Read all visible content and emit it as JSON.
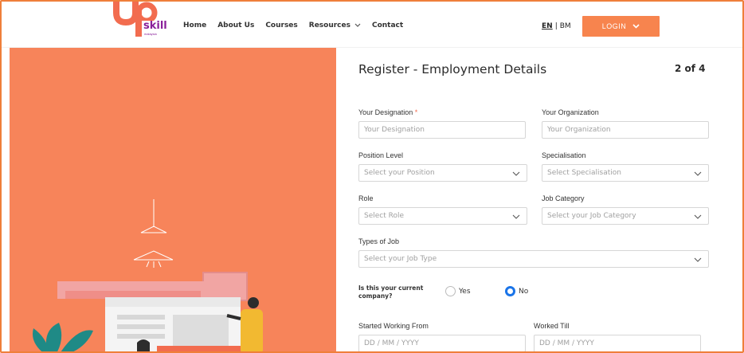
{
  "header": {
    "logo_text_top": "up",
    "logo_text_bottom": "skill",
    "logo_sub": "malaysia",
    "nav": [
      "Home",
      "About Us",
      "Courses",
      "Resources",
      "Contact"
    ],
    "lang_en": "EN",
    "lang_sep": "|",
    "lang_bm": "BM",
    "login_label": "LOGIN"
  },
  "form": {
    "title": "Register - Employment Details",
    "step": "2 of 4",
    "designation": {
      "label": "Your Designation",
      "required": "*",
      "placeholder": "Your Designation"
    },
    "organization": {
      "label": "Your Organization",
      "placeholder": "Your Organization"
    },
    "position_level": {
      "label": "Position Level",
      "placeholder": "Select your Position"
    },
    "specialisation": {
      "label": "Specialisation",
      "placeholder": "Select Specialisation"
    },
    "role": {
      "label": "Role",
      "placeholder": "Select Role"
    },
    "job_category": {
      "label": "Job Category",
      "placeholder": "Select your Job Category"
    },
    "types_of_job": {
      "label": "Types of Job",
      "placeholder": "Select your Job Type"
    },
    "current_company": {
      "label": "Is this your current company?",
      "yes": "Yes",
      "no": "No",
      "selected": "No"
    },
    "started": {
      "label": "Started Working From",
      "placeholder": "DD / MM / YYYY"
    },
    "worked_till": {
      "label": "Worked Till",
      "placeholder": "DD / MM / YYYY"
    }
  },
  "colors": {
    "brand_orange": "#f7844e",
    "panel_orange": "#f7845a",
    "radio_blue": "#1a74e8"
  }
}
